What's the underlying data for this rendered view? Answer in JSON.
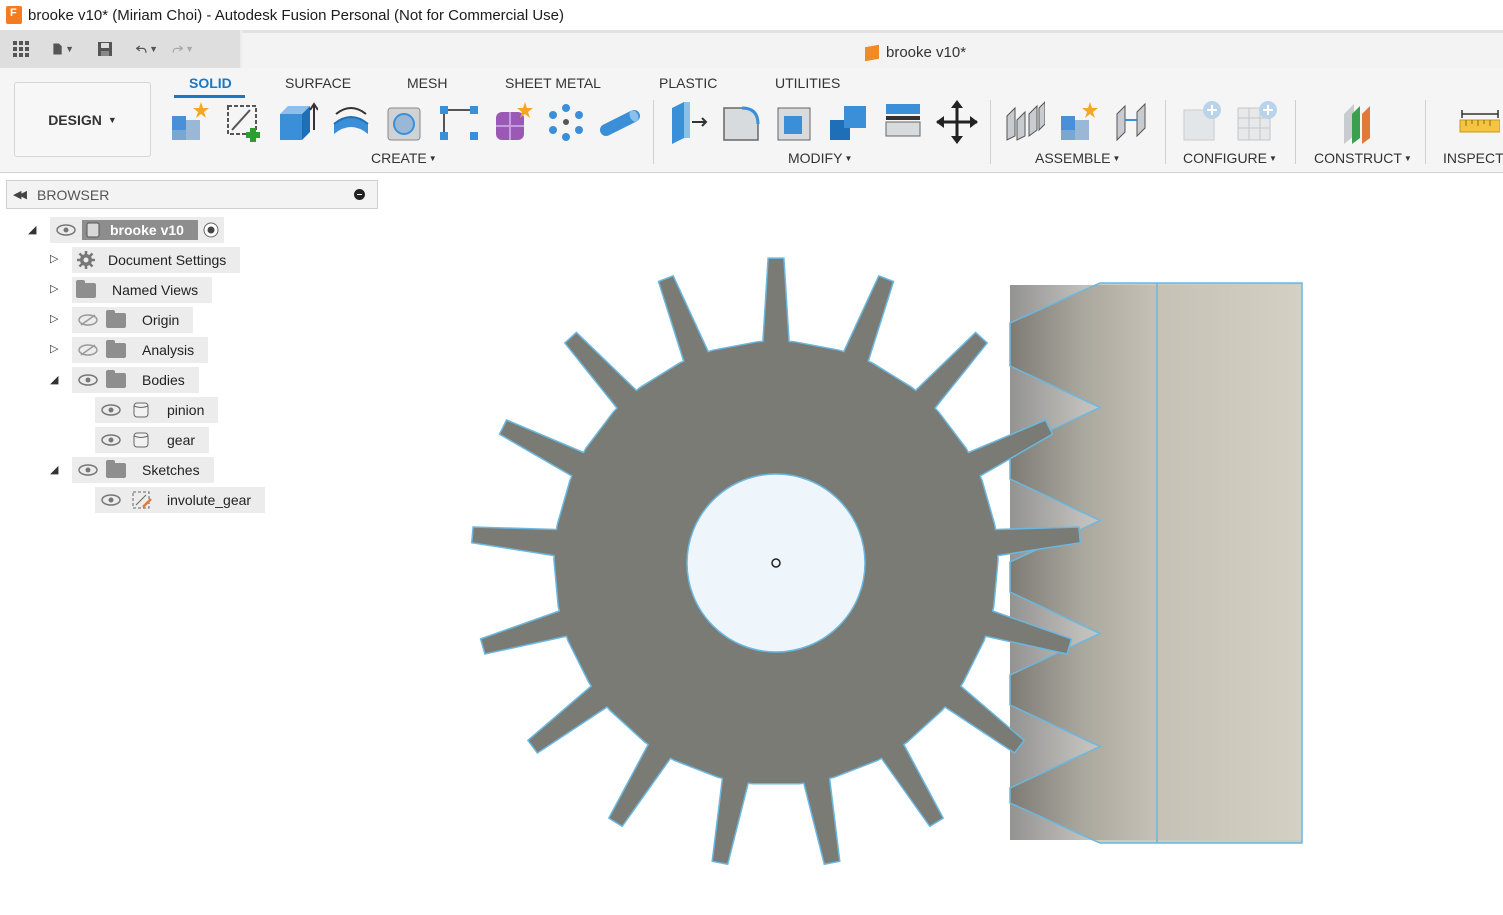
{
  "window": {
    "title": "brooke v10* (Miriam Choi) - Autodesk Fusion Personal (Not for Commercial Use)"
  },
  "quick_access": {
    "icons": [
      "grid-icon",
      "file-icon",
      "save-icon",
      "undo-icon",
      "redo-icon"
    ]
  },
  "document_tab": {
    "title": "brooke v10*"
  },
  "workspace": {
    "label": "DESIGN"
  },
  "tabs": [
    {
      "label": "SOLID",
      "active": true
    },
    {
      "label": "SURFACE"
    },
    {
      "label": "MESH"
    },
    {
      "label": "SHEET METAL"
    },
    {
      "label": "PLASTIC"
    },
    {
      "label": "UTILITIES"
    }
  ],
  "tool_groups": [
    {
      "label": "CREATE",
      "tools": [
        "new-component",
        "create-sketch",
        "extrude",
        "revolve",
        "hole",
        "rectangular-pattern",
        "create-form",
        "circular-pattern",
        "pipe"
      ]
    },
    {
      "label": "MODIFY",
      "tools": [
        "press-pull",
        "fillet",
        "shell",
        "combine",
        "offset-face",
        "move"
      ]
    },
    {
      "label": "ASSEMBLE",
      "tools": [
        "joint",
        "new-component",
        "as-built-joint"
      ]
    },
    {
      "label": "CONFIGURE",
      "tools": [
        "configure-add",
        "configure-table"
      ]
    },
    {
      "label": "CONSTRUCT",
      "tools": [
        "offset-plane"
      ]
    },
    {
      "label": "INSPECT",
      "tools": [
        "measure"
      ]
    }
  ],
  "browser": {
    "title": "BROWSER",
    "root": {
      "label": "brooke v10"
    },
    "items": [
      {
        "label": "Document Settings"
      },
      {
        "label": "Named Views"
      },
      {
        "label": "Origin"
      },
      {
        "label": "Analysis"
      },
      {
        "label": "Bodies"
      },
      {
        "label": "pinion"
      },
      {
        "label": "gear"
      },
      {
        "label": "Sketches"
      },
      {
        "label": "involute_gear"
      }
    ]
  },
  "colors": {
    "accent": "#1a78c2",
    "gear_fill": "#7a7b75",
    "edge": "#6ab8e0",
    "bore": "#eef6fc"
  }
}
